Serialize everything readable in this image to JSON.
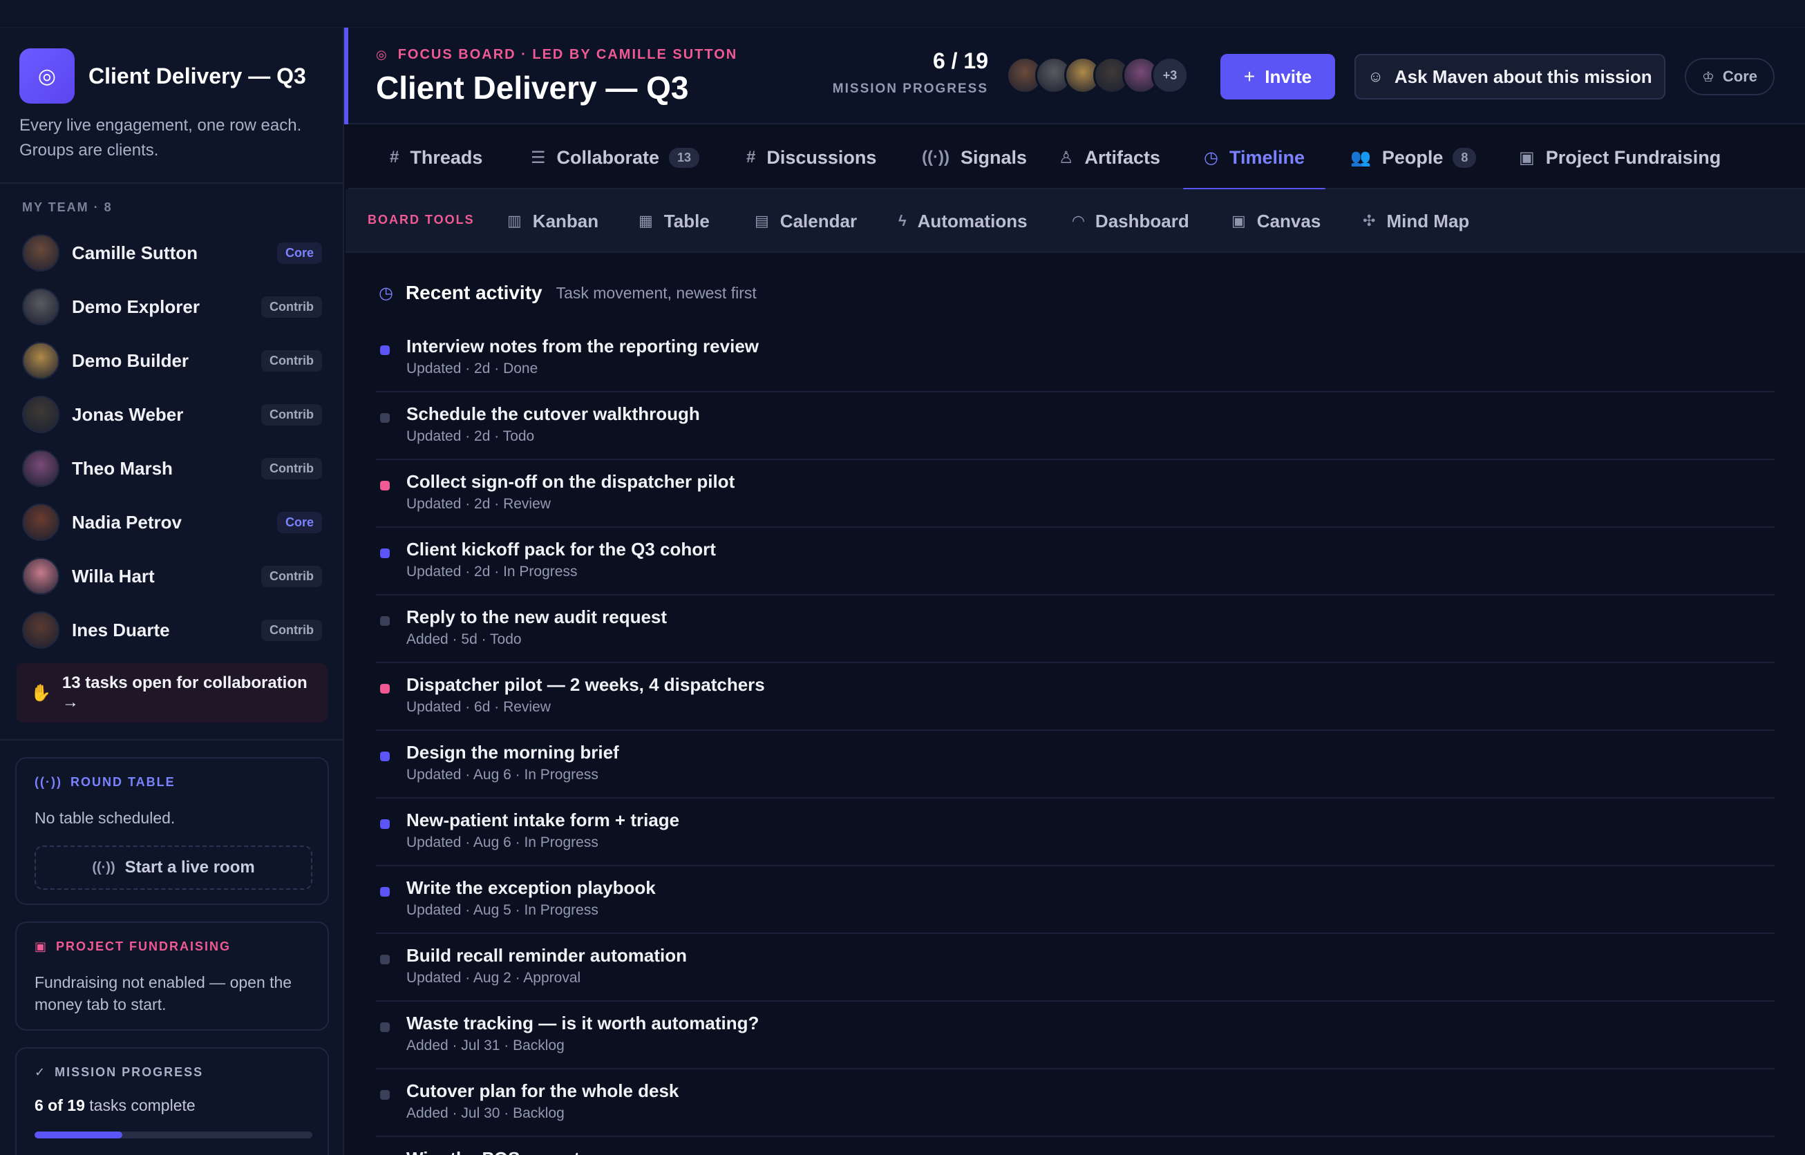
{
  "sidebar": {
    "brand_title": "Client Delivery — Q3",
    "brand_icon": "target-icon",
    "description": "Every live engagement, one row each. Groups are clients.",
    "team_heading": "MY TEAM · 8",
    "members": [
      {
        "name": "Camille Sutton",
        "role": "Core",
        "role_type": "core",
        "avatar_color": "#6b4a3a"
      },
      {
        "name": "Demo Explorer",
        "role": "Contrib",
        "role_type": "contrib",
        "avatar_color": "#5a5a60"
      },
      {
        "name": "Demo Builder",
        "role": "Contrib",
        "role_type": "contrib",
        "avatar_color": "#b08a48"
      },
      {
        "name": "Jonas Weber",
        "role": "Contrib",
        "role_type": "contrib",
        "avatar_color": "#3e3a36"
      },
      {
        "name": "Theo Marsh",
        "role": "Contrib",
        "role_type": "contrib",
        "avatar_color": "#7a4a78"
      },
      {
        "name": "Nadia Petrov",
        "role": "Core",
        "role_type": "core",
        "avatar_color": "#6a3b2e"
      },
      {
        "name": "Willa Hart",
        "role": "Contrib",
        "role_type": "contrib",
        "avatar_color": "#c87a8a"
      },
      {
        "name": "Ines Duarte",
        "role": "Contrib",
        "role_type": "contrib",
        "avatar_color": "#5a3a30"
      }
    ],
    "collab_text": "13 tasks open for collaboration →",
    "round_table": {
      "heading": "ROUND TABLE",
      "text": "No table scheduled.",
      "button": "Start a live room"
    },
    "fundraising": {
      "heading": "PROJECT FUNDRAISING",
      "text": "Fundraising not enabled — open the money tab to start."
    },
    "progress": {
      "heading": "MISSION PROGRESS",
      "count_bold": "6 of 19",
      "count_rest": " tasks complete",
      "fraction": 0.3158
    }
  },
  "header": {
    "eyebrow": "FOCUS BOARD · LED BY CAMILLE SUTTON",
    "title": "Client Delivery — Q3",
    "progress_count": "6 / 19",
    "progress_label": "MISSION PROGRESS",
    "avatar_colors": [
      "#6b4a3a",
      "#5a5a60",
      "#b08a48",
      "#3e3a36",
      "#7a4a78"
    ],
    "more_count": "+3",
    "invite_label": "Invite",
    "ask_label": "Ask Maven about this mission",
    "core_label": "Core"
  },
  "tabs": [
    {
      "label": "Threads",
      "icon": "hash-icon",
      "glyph": "#",
      "badge": ""
    },
    {
      "label": "Collaborate",
      "icon": "list-icon",
      "glyph": "☰",
      "badge": "13"
    },
    {
      "label": "Discussions",
      "icon": "hash-icon",
      "glyph": "#",
      "badge": ""
    },
    {
      "label": "Signals",
      "icon": "broadcast-icon",
      "glyph": "((·))",
      "badge": ""
    },
    {
      "label": "Artifacts",
      "icon": "award-icon",
      "glyph": "♙",
      "badge": ""
    },
    {
      "label": "Timeline",
      "icon": "clock-icon",
      "glyph": "◷",
      "badge": "",
      "active": true
    },
    {
      "label": "People",
      "icon": "people-icon",
      "glyph": "👥",
      "badge": "8"
    },
    {
      "label": "Project Fundraising",
      "icon": "money-icon",
      "glyph": "▣",
      "badge": ""
    }
  ],
  "tools": {
    "label": "BOARD TOOLS",
    "items": [
      {
        "label": "Kanban",
        "icon": "kanban-icon",
        "glyph": "▥"
      },
      {
        "label": "Table",
        "icon": "table-icon",
        "glyph": "▦"
      },
      {
        "label": "Calendar",
        "icon": "calendar-icon",
        "glyph": "▤"
      },
      {
        "label": "Automations",
        "icon": "bolt-icon",
        "glyph": "ϟ"
      },
      {
        "label": "Dashboard",
        "icon": "gauge-icon",
        "glyph": "◠"
      },
      {
        "label": "Canvas",
        "icon": "canvas-icon",
        "glyph": "▣"
      },
      {
        "label": "Mind Map",
        "icon": "mindmap-icon",
        "glyph": "✣"
      }
    ]
  },
  "activity": {
    "title": "Recent activity",
    "subtitle": "Task movement, newest first",
    "items": [
      {
        "title": "Interview notes from the reporting review",
        "meta": "Updated · 2d · Done",
        "color": "#5b55f5"
      },
      {
        "title": "Schedule the cutover walkthrough",
        "meta": "Updated · 2d · Todo",
        "color": "#3a4058"
      },
      {
        "title": "Collect sign-off on the dispatcher pilot",
        "meta": "Updated · 2d · Review",
        "color": "#f05a94"
      },
      {
        "title": "Client kickoff pack for the Q3 cohort",
        "meta": "Updated · 2d · In Progress",
        "color": "#5b55f5"
      },
      {
        "title": "Reply to the new audit request",
        "meta": "Added · 5d · Todo",
        "color": "#3a4058"
      },
      {
        "title": "Dispatcher pilot — 2 weeks, 4 dispatchers",
        "meta": "Updated · 6d · Review",
        "color": "#f05a94"
      },
      {
        "title": "Design the morning brief",
        "meta": "Updated · Aug 6 · In Progress",
        "color": "#5b55f5"
      },
      {
        "title": "New-patient intake form + triage",
        "meta": "Updated · Aug 6 · In Progress",
        "color": "#5b55f5"
      },
      {
        "title": "Write the exception playbook",
        "meta": "Updated · Aug 5 · In Progress",
        "color": "#5b55f5"
      },
      {
        "title": "Build recall reminder automation",
        "meta": "Updated · Aug 2 · Approval",
        "color": "#3a4058"
      },
      {
        "title": "Waste tracking — is it worth automating?",
        "meta": "Added · Jul 31 · Backlog",
        "color": "#3a4058"
      },
      {
        "title": "Cutover plan for the whole desk",
        "meta": "Added · Jul 30 · Backlog",
        "color": "#3a4058"
      },
      {
        "title": "Wire the POS export",
        "meta": "",
        "color": "#3a4058"
      }
    ]
  }
}
